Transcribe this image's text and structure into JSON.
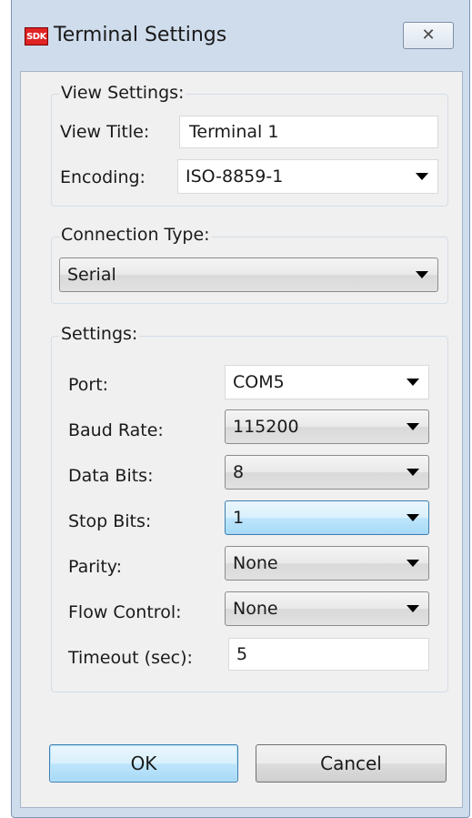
{
  "window": {
    "app_icon_text": "SDK",
    "title": "Terminal Settings",
    "close_glyph": "✕"
  },
  "view_settings": {
    "group_label": "View Settings:",
    "title_label": "View Title:",
    "title_value": "Terminal 1",
    "encoding_label": "Encoding:",
    "encoding_value": "ISO-8859-1"
  },
  "connection": {
    "group_label": "Connection Type:",
    "type_value": "Serial"
  },
  "settings": {
    "group_label": "Settings:",
    "port_label": "Port:",
    "port_value": "COM5",
    "baud_label": "Baud Rate:",
    "baud_value": "115200",
    "data_bits_label": "Data Bits:",
    "data_bits_value": "8",
    "stop_bits_label": "Stop Bits:",
    "stop_bits_value": "1",
    "parity_label": "Parity:",
    "parity_value": "None",
    "flow_label": "Flow Control:",
    "flow_value": "None",
    "timeout_label": "Timeout (sec):",
    "timeout_value": "5"
  },
  "buttons": {
    "ok_label": "OK",
    "cancel_label": "Cancel"
  },
  "colors": {
    "title_accent": "#e02424",
    "focus_blue": "#3c7fb1",
    "frame": "#cfdcec"
  }
}
